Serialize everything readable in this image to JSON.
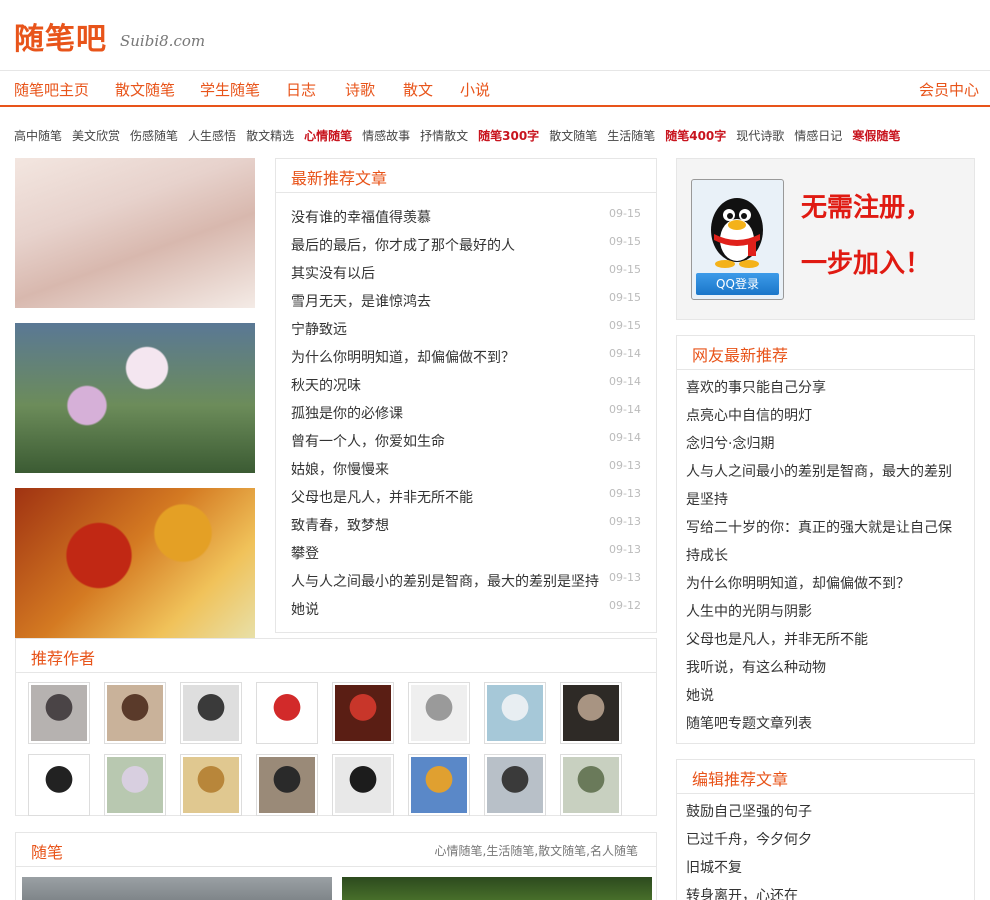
{
  "logo": {
    "cn": "随笔吧",
    "en": "Suibi8.com"
  },
  "nav": {
    "items": [
      "随笔吧主页",
      "散文随笔",
      "学生随笔",
      "日志",
      "诗歌",
      "散文",
      "小说"
    ],
    "member": "会员中心"
  },
  "tags": [
    {
      "label": "高中随笔",
      "hot": false
    },
    {
      "label": "美文欣赏",
      "hot": false
    },
    {
      "label": "伤感随笔",
      "hot": false
    },
    {
      "label": "人生感悟",
      "hot": false
    },
    {
      "label": "散文精选",
      "hot": false
    },
    {
      "label": "心情随笔",
      "hot": true
    },
    {
      "label": "情感故事",
      "hot": false
    },
    {
      "label": "抒情散文",
      "hot": false
    },
    {
      "label": "随笔300字",
      "hot": true
    },
    {
      "label": "散文随笔",
      "hot": false
    },
    {
      "label": "生活随笔",
      "hot": false
    },
    {
      "label": "随笔400字",
      "hot": true
    },
    {
      "label": "现代诗歌",
      "hot": false
    },
    {
      "label": "情感日记",
      "hot": false
    },
    {
      "label": "寒假随笔",
      "hot": true
    }
  ],
  "latest": {
    "title": "最新推荐文章",
    "items": [
      {
        "title": "没有谁的幸福值得羡慕",
        "date": "09-15"
      },
      {
        "title": "最后的最后，你才成了那个最好的人",
        "date": "09-15"
      },
      {
        "title": "其实没有以后",
        "date": "09-15"
      },
      {
        "title": "雪月无天，是谁惊鸿去",
        "date": "09-15"
      },
      {
        "title": "宁静致远",
        "date": "09-15"
      },
      {
        "title": "为什么你明明知道，却偏偏做不到？",
        "date": "09-14"
      },
      {
        "title": "秋天的况味",
        "date": "09-14"
      },
      {
        "title": "孤独是你的必修课",
        "date": "09-14"
      },
      {
        "title": "曾有一个人，你爱如生命",
        "date": "09-14"
      },
      {
        "title": "姑娘，你慢慢来",
        "date": "09-13"
      },
      {
        "title": "父母也是凡人，并非无所不能",
        "date": "09-13"
      },
      {
        "title": "致青春，致梦想",
        "date": "09-13"
      },
      {
        "title": "攀登",
        "date": "09-13"
      },
      {
        "title": "人与人之间最小的差别是智商，最大的差别是坚持",
        "date": "09-13"
      },
      {
        "title": "她说",
        "date": "09-12"
      }
    ]
  },
  "authors": {
    "title": "推荐作者",
    "avatar_colors": [
      [
        "#b6b2b0",
        "#4a4446"
      ],
      [
        "#c9b29a",
        "#5a3a2a"
      ],
      [
        "#dedede",
        "#3a3a3a"
      ],
      [
        "#ffffff",
        "#d22a2a"
      ],
      [
        "#5a1e14",
        "#c8362a"
      ],
      [
        "#efefef",
        "#9a9a9a"
      ],
      [
        "#a6c8d8",
        "#e8eef2"
      ],
      [
        "#2e2a26",
        "#a89482"
      ],
      [
        "#ffffff",
        "#222222"
      ],
      [
        "#b8c8b0",
        "#d8cfe0"
      ],
      [
        "#e0c890",
        "#b8863a"
      ],
      [
        "#9a8a78",
        "#2a2a2a"
      ],
      [
        "#e8e8e8",
        "#1c1c1c"
      ],
      [
        "#5a88c8",
        "#e0a030"
      ],
      [
        "#b8c0c8",
        "#3a3a3a"
      ],
      [
        "#c8d0c0",
        "#6a7a5a"
      ]
    ]
  },
  "suibi": {
    "title": "随笔",
    "sub": "心情随笔,生活随笔,散文随笔,名人随笔"
  },
  "qq": {
    "button": "QQ登录",
    "line1": "无需注册，",
    "line2": "一步加入！"
  },
  "friends": {
    "title": "网友最新推荐",
    "items": [
      "喜欢的事只能自己分享",
      "点亮心中自信的明灯",
      "念归兮·念归期",
      "人与人之间最小的差别是智商，最大的差别",
      "是坚持",
      "写给二十岁的你：真正的强大就是让自己保",
      "持成长",
      "为什么你明明知道，却偏偏做不到？",
      "人生中的光阴与阴影",
      "父母也是凡人，并非无所不能",
      "我听说，有这么种动物",
      "她说",
      "随笔吧专题文章列表"
    ]
  },
  "editor": {
    "title": "编辑推荐文章",
    "items": [
      "鼓励自己坚强的句子",
      "已过千舟，今夕何夕",
      "旧城不复",
      "转身离开，心还在"
    ]
  },
  "colors": {
    "accent": "#e8541a",
    "hot": "#c8141e",
    "slogan": "#e01a12"
  }
}
